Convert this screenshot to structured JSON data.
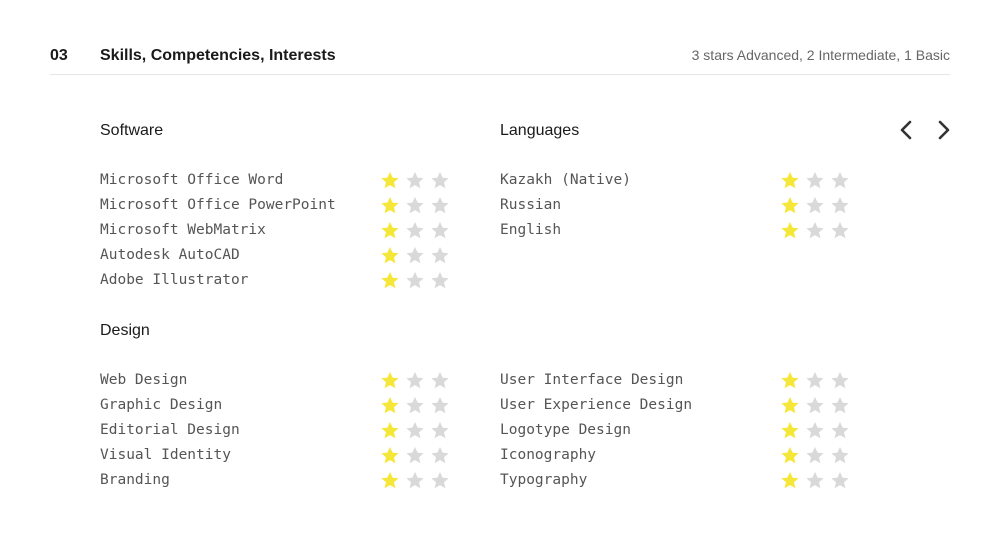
{
  "section": {
    "number": "03",
    "title": "Skills, Competencies, Interests",
    "legend": "3 stars Advanced, 2 Intermediate, 1 Basic"
  },
  "nav": {
    "prev_icon": "chevron-left-icon",
    "next_icon": "chevron-right-icon"
  },
  "colors": {
    "star_filled": "#f5e63a",
    "star_empty": "#d9d9d9",
    "divider": "#e6e6e6",
    "arrow": "#333333"
  },
  "max_stars": 3,
  "groups": {
    "software": {
      "title": "Software",
      "items": [
        {
          "name": "Microsoft Office Word",
          "rating": 1
        },
        {
          "name": "Microsoft Office PowerPoint",
          "rating": 1
        },
        {
          "name": "Microsoft WebMatrix",
          "rating": 1
        },
        {
          "name": "Autodesk AutoCAD",
          "rating": 1
        },
        {
          "name": "Adobe Illustrator",
          "rating": 1
        }
      ]
    },
    "languages": {
      "title": "Languages",
      "items": [
        {
          "name": "Kazakh (Native)",
          "rating": 1
        },
        {
          "name": "Russian",
          "rating": 1
        },
        {
          "name": "English",
          "rating": 1
        }
      ]
    },
    "design": {
      "title": "Design",
      "items": [
        {
          "name": "Web Design",
          "rating": 1
        },
        {
          "name": "Graphic Design",
          "rating": 1
        },
        {
          "name": "Editorial Design",
          "rating": 1
        },
        {
          "name": "Visual Identity",
          "rating": 1
        },
        {
          "name": "Branding",
          "rating": 1
        }
      ]
    },
    "design_more": {
      "title": "",
      "items": [
        {
          "name": "User Interface Design",
          "rating": 1
        },
        {
          "name": "User Experience Design",
          "rating": 1
        },
        {
          "name": "Logotype Design",
          "rating": 1
        },
        {
          "name": "Iconography",
          "rating": 1
        },
        {
          "name": "Typography",
          "rating": 1
        }
      ]
    }
  }
}
